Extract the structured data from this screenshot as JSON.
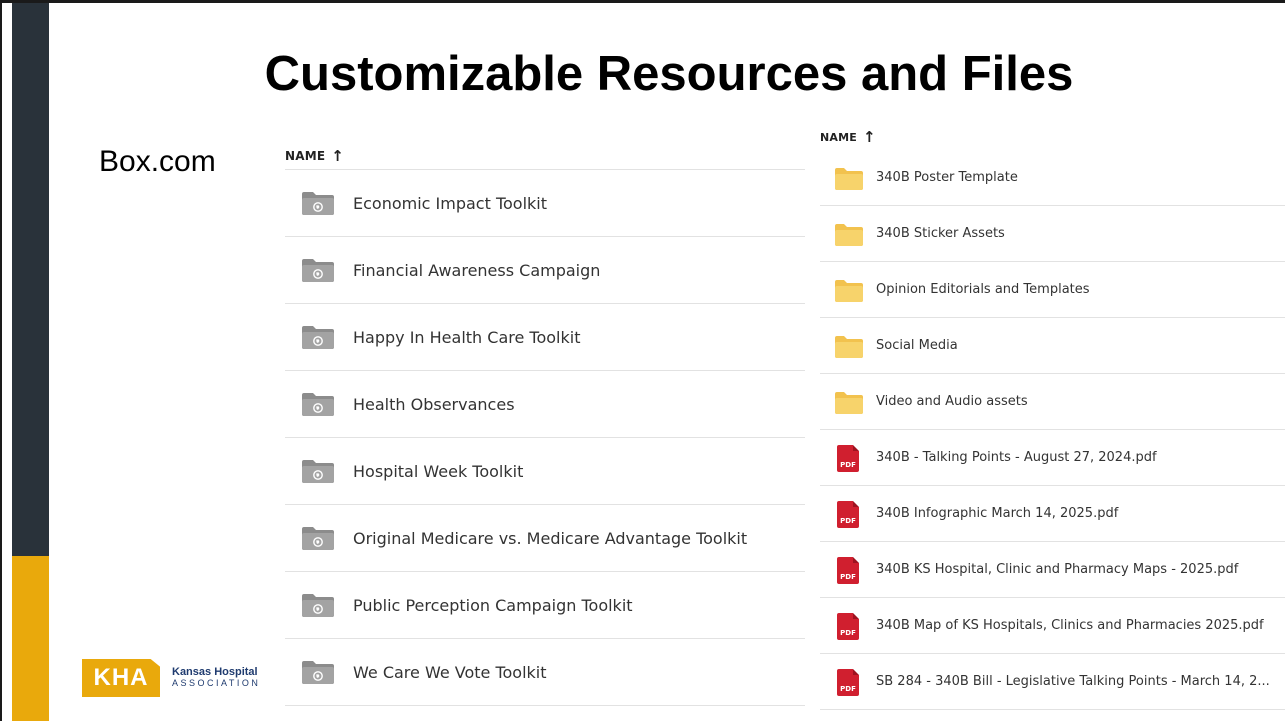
{
  "slide": {
    "title": "Customizable Resources and Files",
    "site_label": "Box.com"
  },
  "left_panel": {
    "column_header": "NAME",
    "items": [
      {
        "label": "Economic Impact Toolkit",
        "icon": "shared-folder-icon"
      },
      {
        "label": "Financial Awareness Campaign",
        "icon": "shared-folder-icon"
      },
      {
        "label": "Happy In Health Care Toolkit",
        "icon": "shared-folder-icon"
      },
      {
        "label": "Health Observances",
        "icon": "shared-folder-icon"
      },
      {
        "label": "Hospital Week Toolkit",
        "icon": "shared-folder-icon"
      },
      {
        "label": "Original Medicare vs. Medicare Advantage Toolkit",
        "icon": "shared-folder-icon"
      },
      {
        "label": "Public Perception Campaign Toolkit",
        "icon": "shared-folder-icon"
      },
      {
        "label": "We Care We Vote Toolkit",
        "icon": "shared-folder-icon"
      }
    ]
  },
  "right_panel": {
    "column_header": "NAME",
    "items": [
      {
        "label": "340B Poster Template",
        "type": "folder"
      },
      {
        "label": "340B Sticker Assets",
        "type": "folder"
      },
      {
        "label": "Opinion Editorials and Templates",
        "type": "folder"
      },
      {
        "label": "Social Media",
        "type": "folder"
      },
      {
        "label": "Video and Audio assets",
        "type": "folder"
      },
      {
        "label": "340B - Talking Points - August 27, 2024.pdf",
        "type": "pdf"
      },
      {
        "label": "340B Infographic March 14, 2025.pdf",
        "type": "pdf"
      },
      {
        "label": "340B KS Hospital, Clinic and Pharmacy Maps - 2025.pdf",
        "type": "pdf"
      },
      {
        "label": "340B Map of KS Hospitals, Clinics and Pharmacies 2025.pdf",
        "type": "pdf"
      },
      {
        "label": "SB 284 - 340B Bill - Legislative Talking Points - March 14, 2...",
        "type": "pdf"
      }
    ],
    "pdf_badge": "PDF"
  },
  "logo": {
    "mark": "KHA",
    "name": "Kansas Hospital",
    "sub": "ASSOCIATION"
  },
  "colors": {
    "sidebar_dark": "#29323a",
    "sidebar_gold": "#e9a90c",
    "folder_gray": "#8c8c8c",
    "folder_yellow": "#f7d36b",
    "pdf_red": "#d01f2f"
  }
}
